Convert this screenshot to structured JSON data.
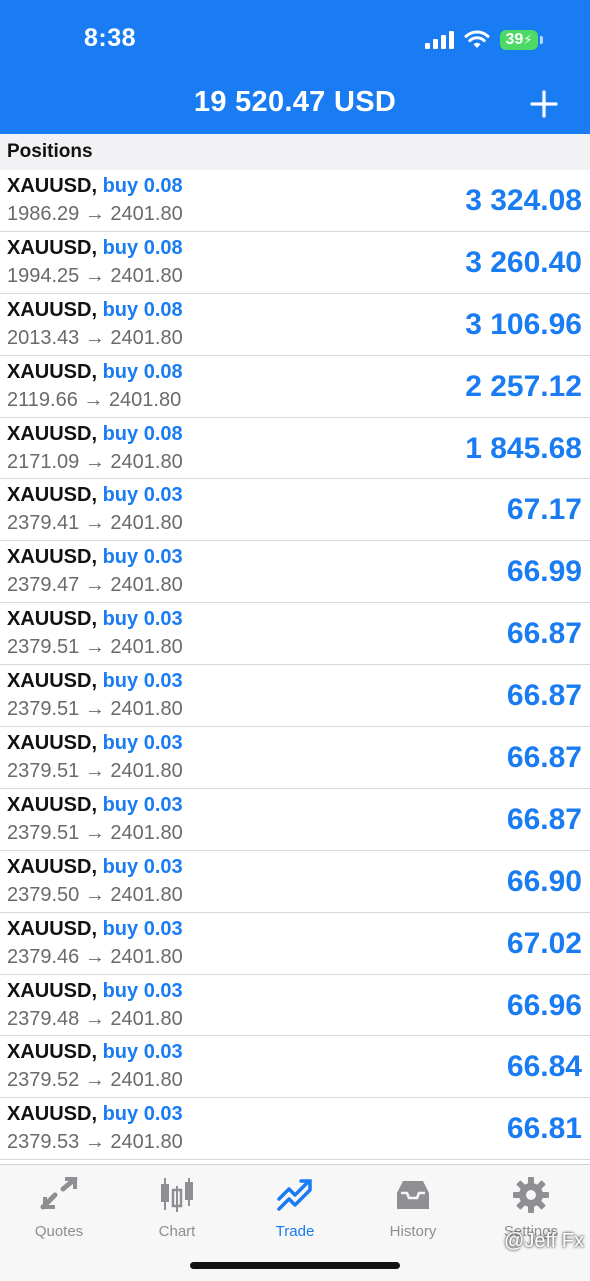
{
  "status_bar": {
    "time": "8:38",
    "battery": "39"
  },
  "header": {
    "balance": "19 520.47 USD"
  },
  "section": {
    "title": "Positions"
  },
  "positions": [
    {
      "symbol": "XAUUSD,",
      "side": "buy 0.08",
      "open": "1986.29",
      "arrow": "→",
      "current": "2401.80",
      "profit": "3 324.08"
    },
    {
      "symbol": "XAUUSD,",
      "side": "buy 0.08",
      "open": "1994.25",
      "arrow": "→",
      "current": "2401.80",
      "profit": "3 260.40"
    },
    {
      "symbol": "XAUUSD,",
      "side": "buy 0.08",
      "open": "2013.43",
      "arrow": "→",
      "current": "2401.80",
      "profit": "3 106.96"
    },
    {
      "symbol": "XAUUSD,",
      "side": "buy 0.08",
      "open": "2119.66",
      "arrow": "→",
      "current": "2401.80",
      "profit": "2 257.12"
    },
    {
      "symbol": "XAUUSD,",
      "side": "buy 0.08",
      "open": "2171.09",
      "arrow": "→",
      "current": "2401.80",
      "profit": "1 845.68"
    },
    {
      "symbol": "XAUUSD,",
      "side": "buy 0.03",
      "open": "2379.41",
      "arrow": "→",
      "current": "2401.80",
      "profit": "67.17"
    },
    {
      "symbol": "XAUUSD,",
      "side": "buy 0.03",
      "open": "2379.47",
      "arrow": "→",
      "current": "2401.80",
      "profit": "66.99"
    },
    {
      "symbol": "XAUUSD,",
      "side": "buy 0.03",
      "open": "2379.51",
      "arrow": "→",
      "current": "2401.80",
      "profit": "66.87"
    },
    {
      "symbol": "XAUUSD,",
      "side": "buy 0.03",
      "open": "2379.51",
      "arrow": "→",
      "current": "2401.80",
      "profit": "66.87"
    },
    {
      "symbol": "XAUUSD,",
      "side": "buy 0.03",
      "open": "2379.51",
      "arrow": "→",
      "current": "2401.80",
      "profit": "66.87"
    },
    {
      "symbol": "XAUUSD,",
      "side": "buy 0.03",
      "open": "2379.51",
      "arrow": "→",
      "current": "2401.80",
      "profit": "66.87"
    },
    {
      "symbol": "XAUUSD,",
      "side": "buy 0.03",
      "open": "2379.50",
      "arrow": "→",
      "current": "2401.80",
      "profit": "66.90"
    },
    {
      "symbol": "XAUUSD,",
      "side": "buy 0.03",
      "open": "2379.46",
      "arrow": "→",
      "current": "2401.80",
      "profit": "67.02"
    },
    {
      "symbol": "XAUUSD,",
      "side": "buy 0.03",
      "open": "2379.48",
      "arrow": "→",
      "current": "2401.80",
      "profit": "66.96"
    },
    {
      "symbol": "XAUUSD,",
      "side": "buy 0.03",
      "open": "2379.52",
      "arrow": "→",
      "current": "2401.80",
      "profit": "66.84"
    },
    {
      "symbol": "XAUUSD,",
      "side": "buy 0.03",
      "open": "2379.53",
      "arrow": "→",
      "current": "2401.80",
      "profit": "66.81"
    }
  ],
  "tabs": [
    {
      "label": "Quotes",
      "icon": "quotes-icon"
    },
    {
      "label": "Chart",
      "icon": "chart-icon"
    },
    {
      "label": "Trade",
      "icon": "trade-icon",
      "active": true
    },
    {
      "label": "History",
      "icon": "history-icon"
    },
    {
      "label": "Settings",
      "icon": "gear-icon"
    }
  ],
  "watermark": "@Jeff Fx",
  "colors": {
    "accent": "#1a7cf2",
    "header_bg": "#1a7cf2",
    "battery": "#4cd964"
  }
}
